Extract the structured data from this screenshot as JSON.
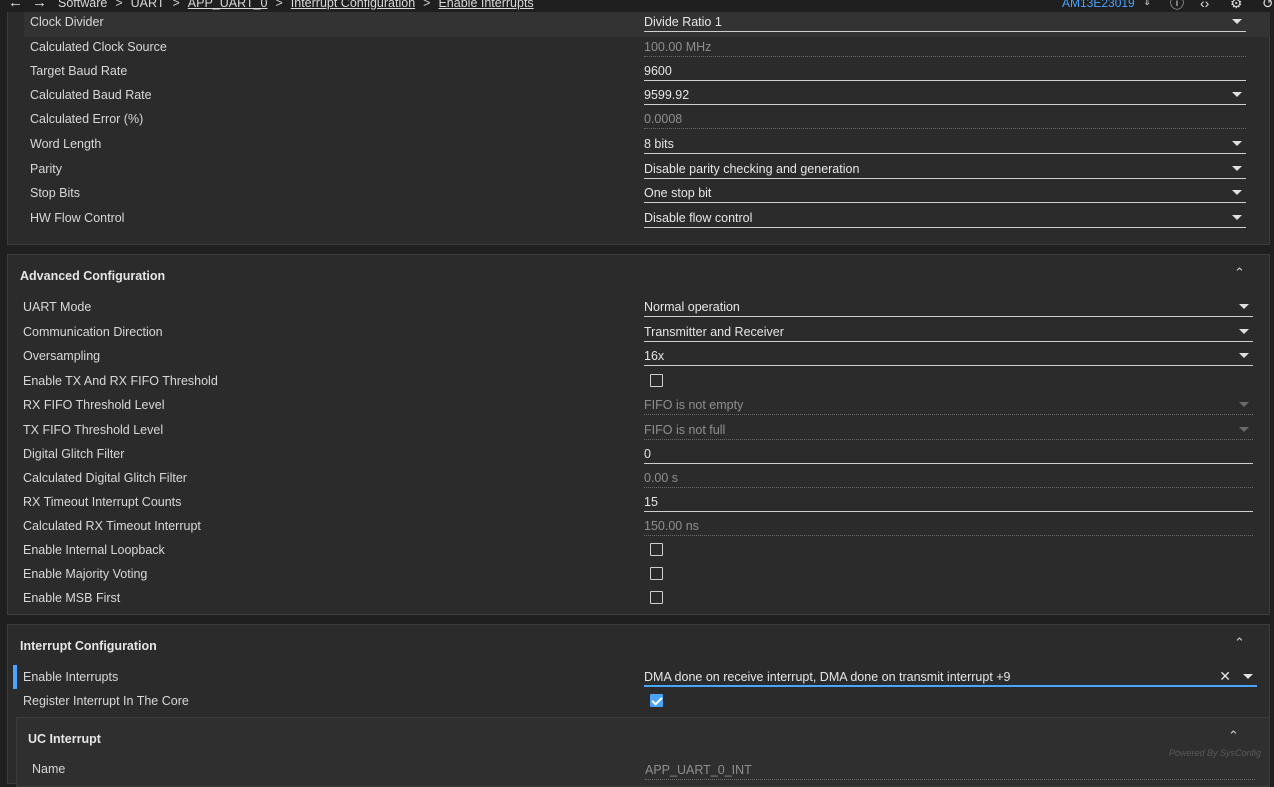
{
  "nav": {
    "breadcrumbs": [
      "Software",
      "UART",
      "APP_UART_0",
      "Interrupt Configuration",
      "Enable Interrupts"
    ],
    "device": "AM13E23019"
  },
  "basic": {
    "rows": [
      {
        "label": "Clock Divider",
        "value": "Divide Ratio 1"
      },
      {
        "label": "Calculated Clock Source",
        "value": "100.00 MHz"
      },
      {
        "label": "Target Baud Rate",
        "value": "9600"
      },
      {
        "label": "Calculated Baud Rate",
        "value": "9599.92"
      },
      {
        "label": "Calculated Error (%)",
        "value": "0.0008"
      },
      {
        "label": "Word Length",
        "value": "8 bits"
      },
      {
        "label": "Parity",
        "value": "Disable parity checking and generation"
      },
      {
        "label": "Stop Bits",
        "value": "One stop bit"
      },
      {
        "label": "HW Flow Control",
        "value": "Disable flow control"
      }
    ]
  },
  "advanced": {
    "title": "Advanced Configuration",
    "rows": [
      {
        "label": "UART Mode",
        "value": "Normal operation"
      },
      {
        "label": "Communication Direction",
        "value": "Transmitter and Receiver"
      },
      {
        "label": "Oversampling",
        "value": "16x"
      },
      {
        "label": "Enable TX And RX FIFO Threshold",
        "checked": false
      },
      {
        "label": "RX FIFO Threshold Level",
        "value": "FIFO is not empty"
      },
      {
        "label": "TX FIFO Threshold Level",
        "value": "FIFO is not full"
      },
      {
        "label": "Digital Glitch Filter",
        "value": "0"
      },
      {
        "label": "Calculated Digital Glitch Filter",
        "value": "0.00 s"
      },
      {
        "label": "RX Timeout Interrupt Counts",
        "value": "15"
      },
      {
        "label": "Calculated RX Timeout Interrupt",
        "value": "150.00 ns"
      },
      {
        "label": "Enable Internal Loopback",
        "checked": false
      },
      {
        "label": "Enable Majority Voting",
        "checked": false
      },
      {
        "label": "Enable MSB First",
        "checked": false
      }
    ]
  },
  "interrupt": {
    "title": "Interrupt Configuration",
    "rows": [
      {
        "label": "Enable Interrupts",
        "value": "DMA done on receive interrupt, DMA done on transmit interrupt +9"
      },
      {
        "label": "Register Interrupt In The Core",
        "checked": true
      }
    ],
    "sub": {
      "title": "UC Interrupt",
      "name_label": "Name",
      "name_value": "APP_UART_0_INT"
    }
  },
  "footer": {
    "watermark": "Powered By SysConfig"
  },
  "colors": {
    "accent": "#4aa3ff",
    "panel": "#2b2b2b",
    "background": "#1f1f1f"
  }
}
